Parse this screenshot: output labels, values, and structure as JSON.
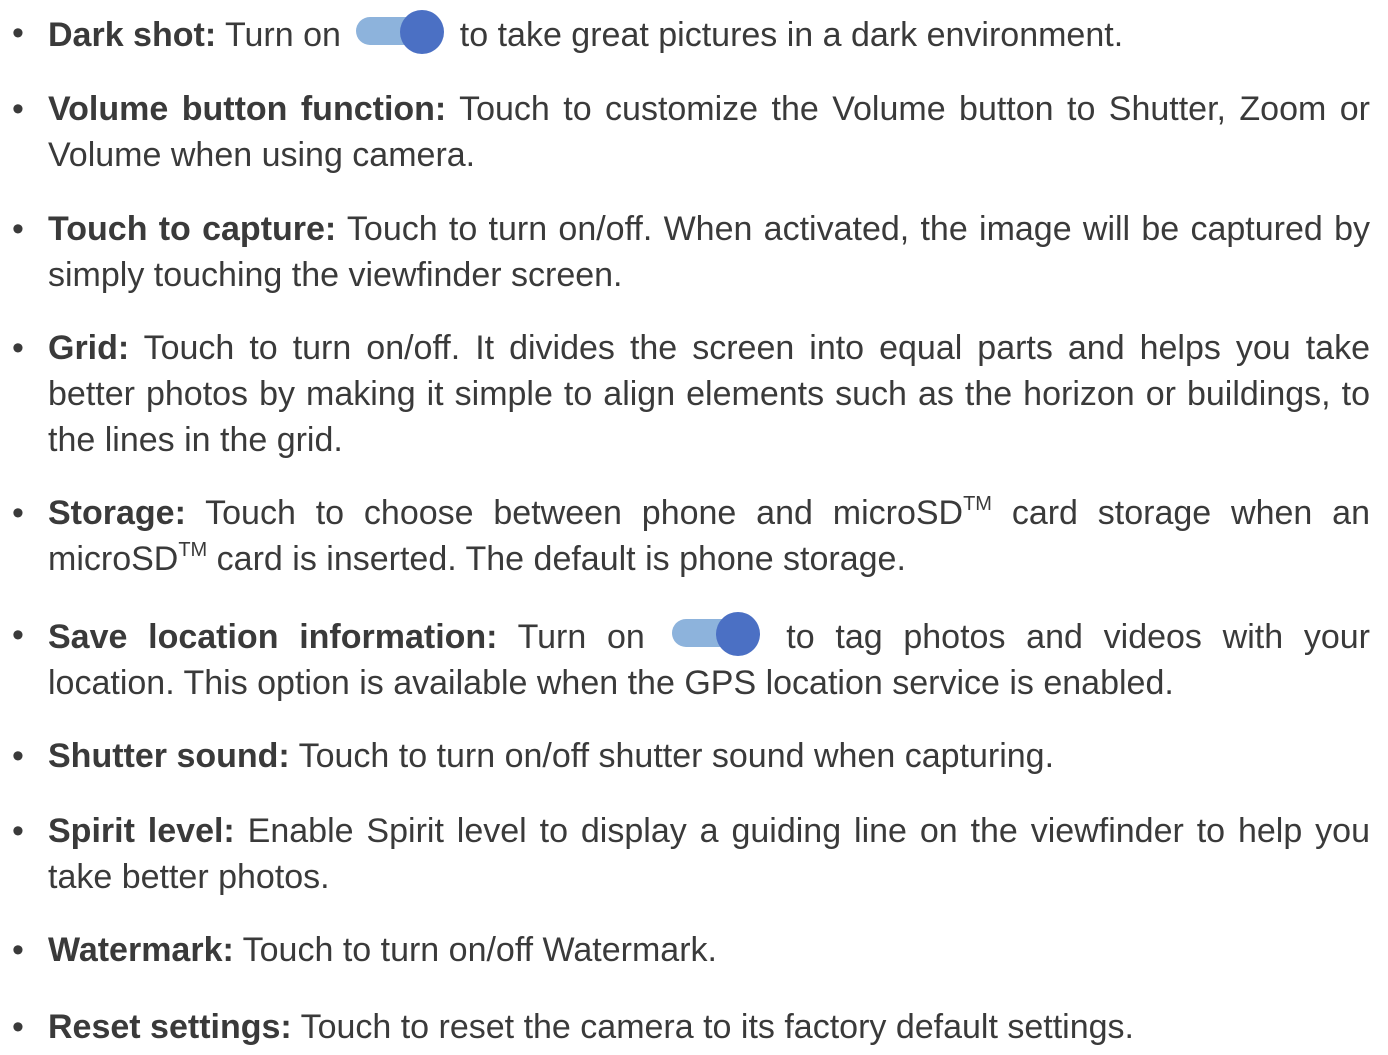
{
  "toggle_colors": {
    "track": "#8db3dc",
    "thumb": "#4b70c4"
  },
  "items": [
    {
      "bullet": "•",
      "label": "Dark shot:",
      "before_toggle": " Turn on ",
      "after_toggle": " to take great pictures in a dark environment.",
      "toggle_state": "on"
    },
    {
      "bullet": "•",
      "label": "Volume button function:",
      "text": " Touch to customize the Volume button to Shutter, Zoom or Volume when using camera."
    },
    {
      "bullet": "•",
      "label": "Touch to capture:",
      "text": " Touch to turn on/off. When activated, the image will be captured by simply touching the viewfinder screen."
    },
    {
      "bullet": "•",
      "label": "Grid:",
      "text": " Touch to turn on/off. It divides the screen into equal parts and helps you take better photos by making it simple to align elements such as the horizon or buildings, to the lines in the grid."
    },
    {
      "bullet": "•",
      "label": "Storage:",
      "text_1": " Touch to choose between phone and microSD",
      "tm_1": "TM",
      "text_2": " card storage when an microSD",
      "tm_2": "TM",
      "text_3": " card is inserted. The default is phone storage."
    },
    {
      "bullet": "•",
      "label": "Save location information:",
      "before_toggle": " Turn on ",
      "after_toggle": " to tag photos and videos with your location. This option is available when the GPS location service is enabled.",
      "toggle_state": "on"
    },
    {
      "bullet": "•",
      "label": "Shutter sound:",
      "text": " Touch to turn on/off shutter sound when capturing."
    },
    {
      "bullet": "•",
      "label": "Spirit level:",
      "text": " Enable Spirit level to display a guiding line on the viewfinder to help you take better photos."
    },
    {
      "bullet": "•",
      "label": "Watermark:",
      "text": " Touch to turn on/off Watermark."
    },
    {
      "bullet": "•",
      "label": "Reset settings:",
      "text": " Touch to reset the camera to its factory default settings."
    }
  ]
}
